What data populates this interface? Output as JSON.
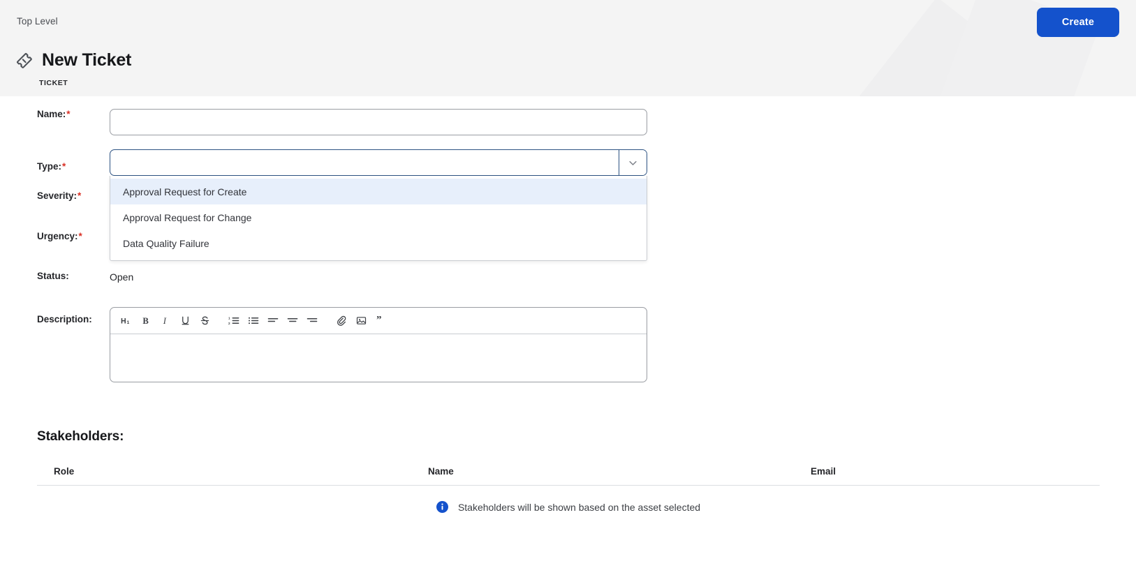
{
  "header": {
    "breadcrumb": "Top Level",
    "title": "New Ticket",
    "entity_kind": "TICKET",
    "create_label": "Create",
    "accent_color": "#1452cc",
    "ticket_icon": "ticket-icon"
  },
  "form": {
    "name": {
      "label": "Name:",
      "required": "*",
      "value": "",
      "placeholder": ""
    },
    "type": {
      "label": "Type:",
      "required": "*",
      "value": "",
      "placeholder": "",
      "toggle_icon": "chevron-down-icon",
      "options": [
        "Approval Request for Create",
        "Approval Request for Change",
        "Data Quality Failure"
      ],
      "highlighted_index": 0
    },
    "severity": {
      "label": "Severity:",
      "required": "*",
      "value": ""
    },
    "urgency": {
      "label": "Urgency:",
      "required": "*",
      "value": ""
    },
    "status": {
      "label": "Status:",
      "value": "Open"
    },
    "description": {
      "label": "Description:",
      "value": "",
      "toolbar": [
        {
          "name": "heading-1-icon",
          "label": "H1"
        },
        {
          "name": "bold-icon",
          "label": "B"
        },
        {
          "name": "italic-icon",
          "label": "I"
        },
        {
          "name": "underline-icon",
          "label": "U"
        },
        {
          "name": "strikethrough-icon",
          "label": "S"
        },
        {
          "name": "ordered-list-icon",
          "label": ""
        },
        {
          "name": "bullet-list-icon",
          "label": ""
        },
        {
          "name": "align-left-icon",
          "label": ""
        },
        {
          "name": "align-center-icon",
          "label": ""
        },
        {
          "name": "align-right-icon",
          "label": ""
        },
        {
          "name": "attachment-icon",
          "label": ""
        },
        {
          "name": "image-icon",
          "label": ""
        },
        {
          "name": "blockquote-icon",
          "label": ""
        }
      ]
    }
  },
  "stakeholders": {
    "heading": "Stakeholders:",
    "columns": {
      "role": "Role",
      "name": "Name",
      "email": "Email"
    },
    "rows": [],
    "empty_message": "Stakeholders will be shown based on the asset selected",
    "info_icon": "info-icon",
    "info_color": "#1452cc"
  }
}
